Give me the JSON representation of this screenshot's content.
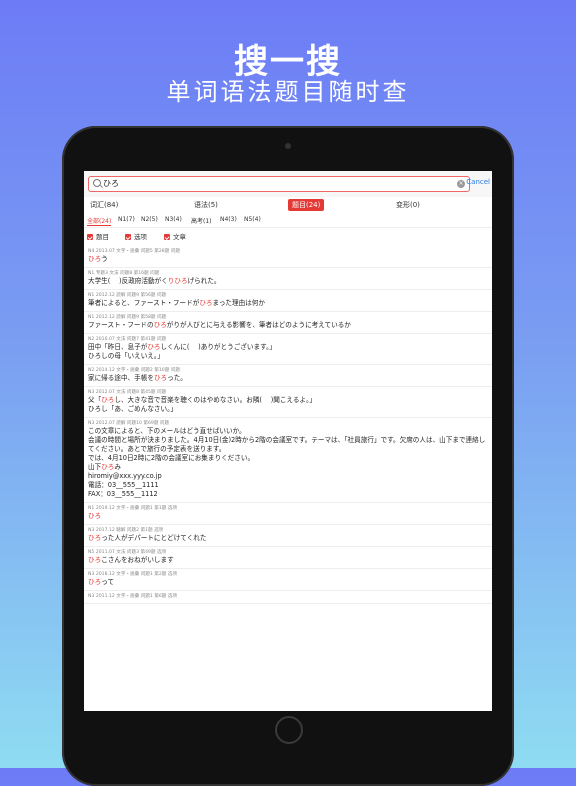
{
  "hero": {
    "title": "搜一搜",
    "subtitle": "单词语法题目随时查"
  },
  "search": {
    "value": "ひろ",
    "cancel_label": "Cancel"
  },
  "tabs": [
    {
      "label": "词汇(84)"
    },
    {
      "label": "语法(5)"
    },
    {
      "label": "题目(24)"
    },
    {
      "label": "变形(0)"
    }
  ],
  "levels": [
    {
      "label": "全部(24)"
    },
    {
      "label": "N1(7)"
    },
    {
      "label": "N2(5)"
    },
    {
      "label": "N3(4)"
    },
    {
      "label": "高考(1)"
    },
    {
      "label": "N4(3)"
    },
    {
      "label": "N5(4)"
    }
  ],
  "filters": [
    {
      "label": "题目"
    },
    {
      "label": "选项"
    },
    {
      "label": "文章"
    }
  ],
  "results": [
    {
      "meta": "N4 2013.07 文字・語彙 问题5 第28题 问题",
      "pre": "",
      "hl": "ひろ",
      "post": "う"
    },
    {
      "meta": "N1 专题3 文法 问题8 第16题 问题",
      "pre": "大学生(　 )反政府活動がく",
      "hl": "りひろ",
      "post": "げられた。"
    },
    {
      "meta": "N1 2012.12 読解 问题9 第56题 问题",
      "pre": "筆者によると、ファースト・フードが",
      "hl": "ひろ",
      "post": "まった理由は何か"
    },
    {
      "meta": "N1 2012.12 読解 问题9 第58题 问题",
      "pre": "ファースト・フードの",
      "hl": "ひろ",
      "post": "がりが人びとに与える影響を、筆者はどのように考えているか"
    },
    {
      "meta": "N2 2016.07 文法 问题7 第41题 问题",
      "pre": "田中「昨日、息子が",
      "hl": "ひろ",
      "post": "しくんに(　 )ありがとうございます。」\nひろしの母「いえいえ。」"
    },
    {
      "meta": "N2 2014.12 文字・語彙 问题2 第10题 问题",
      "pre": "家に帰る途中、手帳を",
      "hl": "ひろ",
      "post": "った。"
    },
    {
      "meta": "N3 2012.07 文法 问题8 第45题 问题",
      "pre": "父「",
      "hl": "ひろ",
      "post": "し、大きな音で音楽を聴くのはやめなさい。お隣(　 )聞こえるよ。」\nひろし「あ、ごめんなさい。」"
    },
    {
      "meta": "N3 2012.07 読解 问题10 第69题 问题",
      "pre": "この文章によると、下のメールはどう直せばいいか。\n会議の時間と場所が決まりました。4月10日(金)2時から2階の会議室です。テーマは、「社員旅行」です。欠席の人は、山下まで連絡してください。あとで旅行の予定表を送ります。\nでは、4月10日2時に2階の会議室にお集まりください。\n山下",
      "hl": "ひろ",
      "post": "み\nhiromiy@xxx.yyy.co.jp\n電話：03__555__1111\nFAX：03__555__1112"
    },
    {
      "meta": "N1 2019.12 文字・語彙 问题1 第1题 选项",
      "pre": "",
      "hl": "ひろ",
      "post": ""
    },
    {
      "meta": "N3 2017.12 聴解 问题2 第1题 选项",
      "pre": "",
      "hl": "ひろ",
      "post": "った人がデパートにとどけてくれた"
    },
    {
      "meta": "N5 2011.07 文法 问题3 第49题 选项",
      "pre": "",
      "hl": "ひろ",
      "post": "こさんをおねがいします"
    },
    {
      "meta": "N3 2018.12 文字・語彙 问题1 第2题 选项",
      "pre": "",
      "hl": "ひろ",
      "post": "って"
    },
    {
      "meta": "N3 2011.12 文字・語彙 问题1 第6题 选项",
      "pre": "",
      "hl": "",
      "post": ""
    }
  ]
}
